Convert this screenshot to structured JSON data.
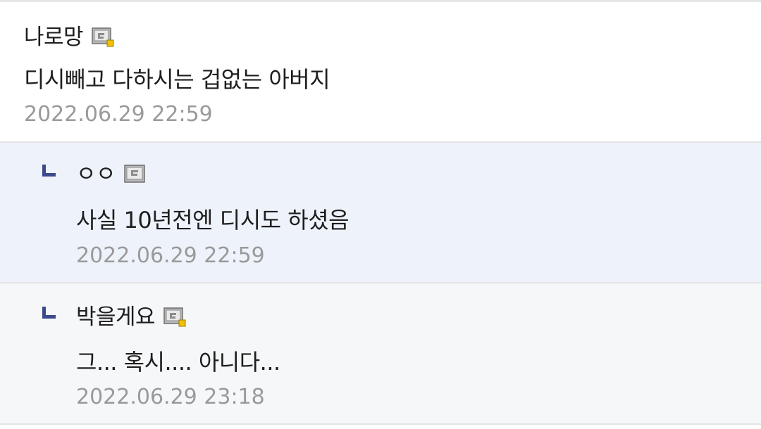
{
  "comments": [
    {
      "nickname": "나로망",
      "badge_icon": "fixed-nick-badge-icon",
      "text": "디시빼고 다하시는 겁없는 아버지",
      "date": "2022.06.29 22:59"
    },
    {
      "nickname": "ㅇㅇ",
      "badge_icon": "nick-badge-icon",
      "reply_icon": "reply-arrow-icon",
      "text": "사실 10년전엔 디시도 하셨음",
      "date": "2022.06.29 22:59"
    },
    {
      "nickname": "박을게요",
      "badge_icon": "fixed-nick-badge-icon",
      "reply_icon": "reply-arrow-icon",
      "text": "그... 혹시.... 아니다...",
      "date": "2022.06.29 23:18"
    }
  ],
  "colors": {
    "reply_icon": "#3b4a8a",
    "badge_gold": "#f2c200",
    "date_text": "#9a9a9a",
    "highlight_bg": "#eef2fb"
  }
}
